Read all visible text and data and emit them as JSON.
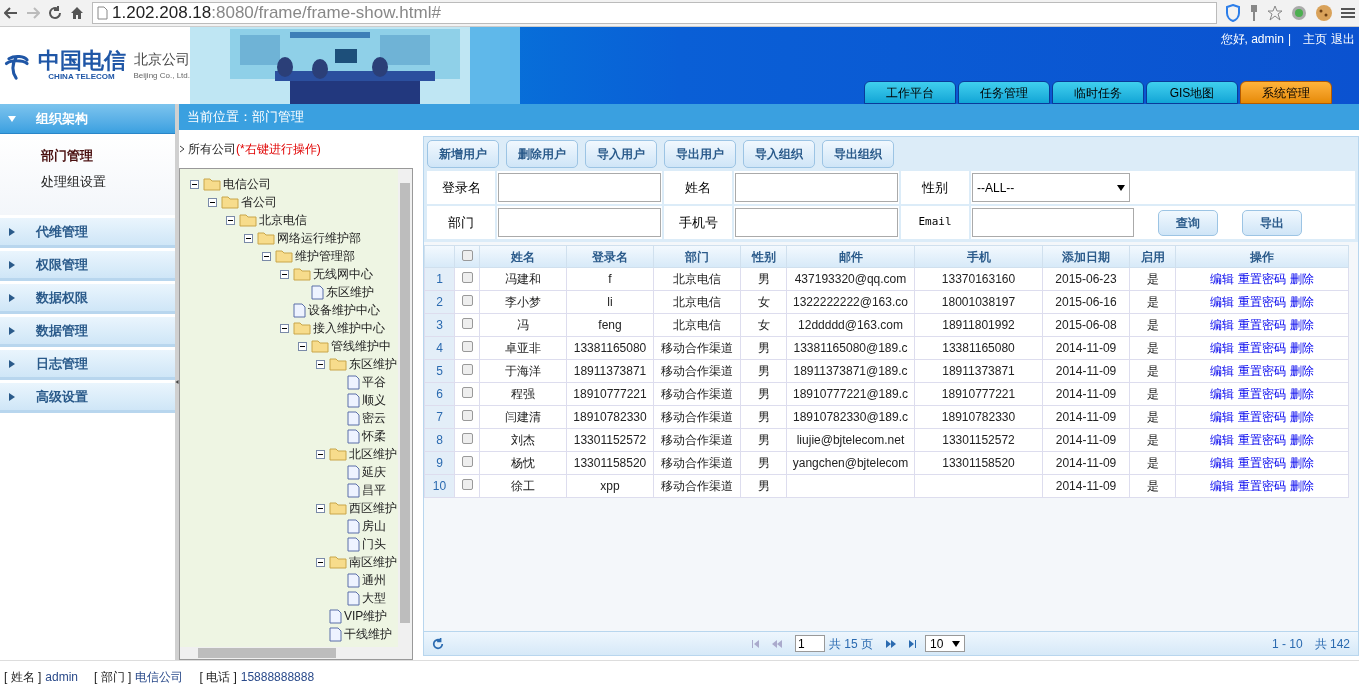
{
  "browser": {
    "url_host": "1.202.208.18",
    "url_rest": ":8080/frame/frame-show.html#"
  },
  "header": {
    "logo_cn": "中国电信",
    "logo_en": "CHINA TELECOM",
    "company_cn": "北京公司",
    "company_en": "Beijing Co., Ltd.",
    "greeting": "您好, admin",
    "separator": "|",
    "links": [
      "主页",
      "退出"
    ],
    "tabs": [
      {
        "label": "工作平台",
        "selected": false
      },
      {
        "label": "任务管理",
        "selected": false
      },
      {
        "label": "临时任务",
        "selected": false
      },
      {
        "label": "GIS地图",
        "selected": false
      },
      {
        "label": "系统管理",
        "selected": true
      }
    ]
  },
  "sidebar": {
    "groups": [
      {
        "label": "组织架构",
        "expanded": true,
        "items": [
          {
            "label": "部门管理",
            "selected": true
          },
          {
            "label": "处理组设置",
            "selected": false
          }
        ]
      },
      {
        "label": "代维管理",
        "expanded": false
      },
      {
        "label": "权限管理",
        "expanded": false
      },
      {
        "label": "数据权限",
        "expanded": false
      },
      {
        "label": "数据管理",
        "expanded": false
      },
      {
        "label": "日志管理",
        "expanded": false
      },
      {
        "label": "高级设置",
        "expanded": false
      }
    ]
  },
  "breadcrumb": "当前位置：部门管理",
  "tree": {
    "root_label": "所有公司",
    "hint": "(*右键进行操作)",
    "nodes": [
      {
        "label": "电信公司",
        "kind": "folder",
        "expanded": true,
        "children": [
          {
            "label": "省公司",
            "kind": "folder",
            "expanded": true,
            "children": [
              {
                "label": "北京电信",
                "kind": "folder",
                "expanded": true,
                "children": [
                  {
                    "label": "网络运行维护部",
                    "kind": "folder",
                    "expanded": true,
                    "children": [
                      {
                        "label": "维护管理部",
                        "kind": "folder",
                        "expanded": true,
                        "children": [
                          {
                            "label": "无线网中心",
                            "kind": "folder",
                            "expanded": true,
                            "children": [
                              {
                                "label": "东区维护",
                                "kind": "file"
                              }
                            ]
                          },
                          {
                            "label": "设备维护中心",
                            "kind": "file"
                          },
                          {
                            "label": "接入维护中心",
                            "kind": "folder",
                            "expanded": true,
                            "children": [
                              {
                                "label": "管线维护中",
                                "kind": "folder",
                                "expanded": true,
                                "children": [
                                  {
                                    "label": "东区维护",
                                    "kind": "folder",
                                    "expanded": true,
                                    "children": [
                                      {
                                        "label": "平谷",
                                        "kind": "file"
                                      },
                                      {
                                        "label": "顺义",
                                        "kind": "file"
                                      },
                                      {
                                        "label": "密云",
                                        "kind": "file"
                                      },
                                      {
                                        "label": "怀柔",
                                        "kind": "file"
                                      }
                                    ]
                                  },
                                  {
                                    "label": "北区维护",
                                    "kind": "folder",
                                    "expanded": true,
                                    "children": [
                                      {
                                        "label": "延庆",
                                        "kind": "file"
                                      },
                                      {
                                        "label": "昌平",
                                        "kind": "file"
                                      }
                                    ]
                                  },
                                  {
                                    "label": "西区维护",
                                    "kind": "folder",
                                    "expanded": true,
                                    "children": [
                                      {
                                        "label": "房山",
                                        "kind": "file"
                                      },
                                      {
                                        "label": "门头",
                                        "kind": "file"
                                      }
                                    ]
                                  },
                                  {
                                    "label": "南区维护",
                                    "kind": "folder",
                                    "expanded": true,
                                    "children": [
                                      {
                                        "label": "通州",
                                        "kind": "file"
                                      },
                                      {
                                        "label": "大型",
                                        "kind": "file"
                                      }
                                    ]
                                  },
                                  {
                                    "label": "VIP维护",
                                    "kind": "file"
                                  },
                                  {
                                    "label": "干线维护",
                                    "kind": "file"
                                  }
                                ]
                              }
                            ]
                          }
                        ]
                      }
                    ]
                  }
                ]
              }
            ]
          }
        ]
      }
    ]
  },
  "toolbar": [
    "新增用户",
    "删除用户",
    "导入用户",
    "导出用户",
    "导入组织",
    "导出组织"
  ],
  "search": {
    "fields": [
      {
        "label": "登录名"
      },
      {
        "label": "姓名"
      },
      {
        "label": "部门"
      },
      {
        "label": "手机号"
      },
      {
        "label": "Email"
      }
    ],
    "gender_label": "性别",
    "gender_value": "--ALL--",
    "buttons": [
      "查询",
      "导出"
    ]
  },
  "table": {
    "select_all": false,
    "columns": [
      "姓名",
      "登录名",
      "部门",
      "性别",
      "邮件",
      "手机",
      "添加日期",
      "启用",
      "操作"
    ],
    "rows": [
      {
        "index": "1",
        "checked": false,
        "cells": [
          "冯建和",
          "f",
          "北京电信",
          "男",
          "437193320@qq.com",
          "13370163160",
          "2015-06-23",
          "是"
        ],
        "actions": [
          "编辑",
          "重置密码",
          "删除"
        ]
      },
      {
        "index": "2",
        "checked": false,
        "cells": [
          "李小梦",
          "li",
          "北京电信",
          "女",
          "1322222222@163.co",
          "18001038197",
          "2015-06-16",
          "是"
        ],
        "actions": [
          "编辑",
          "重置密码",
          "删除"
        ]
      },
      {
        "index": "3",
        "checked": false,
        "cells": [
          "冯",
          "feng",
          "北京电信",
          "女",
          "12ddddd@163.com",
          "18911801992",
          "2015-06-08",
          "是"
        ],
        "actions": [
          "编辑",
          "重置密码",
          "删除"
        ]
      },
      {
        "index": "4",
        "checked": false,
        "cells": [
          "卓亚非",
          "13381165080",
          "移动合作渠道",
          "男",
          "13381165080@189.c",
          "13381165080",
          "2014-11-09",
          "是"
        ],
        "actions": [
          "编辑",
          "重置密码",
          "删除"
        ]
      },
      {
        "index": "5",
        "checked": false,
        "cells": [
          "于海洋",
          "18911373871",
          "移动合作渠道",
          "男",
          "18911373871@189.c",
          "18911373871",
          "2014-11-09",
          "是"
        ],
        "actions": [
          "编辑",
          "重置密码",
          "删除"
        ]
      },
      {
        "index": "6",
        "checked": false,
        "cells": [
          "程强",
          "18910777221",
          "移动合作渠道",
          "男",
          "18910777221@189.c",
          "18910777221",
          "2014-11-09",
          "是"
        ],
        "actions": [
          "编辑",
          "重置密码",
          "删除"
        ]
      },
      {
        "index": "7",
        "checked": false,
        "cells": [
          "闫建清",
          "18910782330",
          "移动合作渠道",
          "男",
          "18910782330@189.c",
          "18910782330",
          "2014-11-09",
          "是"
        ],
        "actions": [
          "编辑",
          "重置密码",
          "删除"
        ]
      },
      {
        "index": "8",
        "checked": false,
        "cells": [
          "刘杰",
          "13301152572",
          "移动合作渠道",
          "男",
          "liujie@bjtelecom.net",
          "13301152572",
          "2014-11-09",
          "是"
        ],
        "actions": [
          "编辑",
          "重置密码",
          "删除"
        ]
      },
      {
        "index": "9",
        "checked": false,
        "cells": [
          "杨忱",
          "13301158520",
          "移动合作渠道",
          "男",
          "yangchen@bjtelecom",
          "13301158520",
          "2014-11-09",
          "是"
        ],
        "actions": [
          "编辑",
          "重置密码",
          "删除"
        ]
      },
      {
        "index": "10",
        "checked": false,
        "cells": [
          "徐工",
          "xpp",
          "移动合作渠道",
          "男",
          "",
          "",
          "2014-11-09",
          "是"
        ],
        "actions": [
          "编辑",
          "重置密码",
          "删除"
        ]
      }
    ]
  },
  "pager": {
    "page": "1",
    "total_pages": "共 15 页",
    "page_size": "10",
    "range": "1 - 10",
    "total": "共 142"
  },
  "footer": [
    {
      "label": "[ 姓名 ]",
      "value": "admin"
    },
    {
      "label": "[ 部门 ]",
      "value": "电信公司"
    },
    {
      "label": "[ 电话 ]",
      "value": "15888888888"
    }
  ]
}
